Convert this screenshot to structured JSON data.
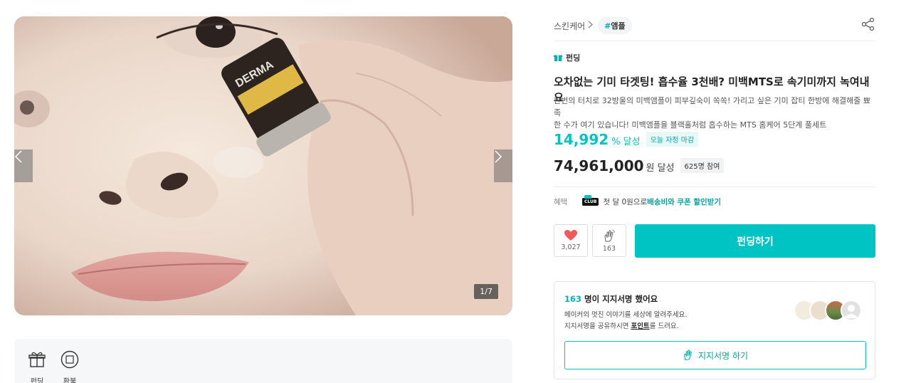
{
  "gallery": {
    "counter": "1/7",
    "product_text": "DERMA"
  },
  "tabs": [
    {
      "label": "펀딩"
    },
    {
      "label": "환불"
    }
  ],
  "breadcrumb": {
    "category": "스킨케어",
    "tag_hash": "#",
    "tag": "앰플"
  },
  "project": {
    "type_label": "펀딩",
    "title": "오차없는 기미 타겟팅! 흡수율 3천배? 미백MTS로 속기미까지 녹여내요",
    "description_line1": "한번의 터치로 32방울의 미백앰플이 피부깊숙이 쏙쏙! 가리고 싶은 기미 잡티 한방에 해결해줄 뾰족",
    "description_line2": "한 수가 여기 있습니다! 미백앰플을 블랙홀처럼 흡수하는 MTS 홈케어 5단계 풀세트",
    "achievement_rate": "14,992",
    "achievement_unit": "% 달성",
    "deadline_badge": "오늘 자정 마감",
    "amount": "74,961,000",
    "amount_unit": "원 달성",
    "participants_badge": "625명 참여"
  },
  "benefit": {
    "label": "혜택",
    "club": "CLUB",
    "text": "첫 달 0원으로 ",
    "link": "배송비와 쿠폰 할인받기"
  },
  "actions": {
    "like_count": "3,027",
    "cheer_count": "163",
    "fund_label": "펀딩하기"
  },
  "support": {
    "count": "163",
    "title_suffix": " 명이 지지서명 했어요",
    "line1": "메이커의 멋진 이야기를 세상에 알려주세요.",
    "line2_prefix": "지지서명을 공유하시면 ",
    "line2_point": "포인트",
    "line2_suffix": "를 드려요.",
    "button_label": "지지서명 하기"
  },
  "colors": {
    "accent": "#00c4c4",
    "heart": "#f25a5a"
  }
}
